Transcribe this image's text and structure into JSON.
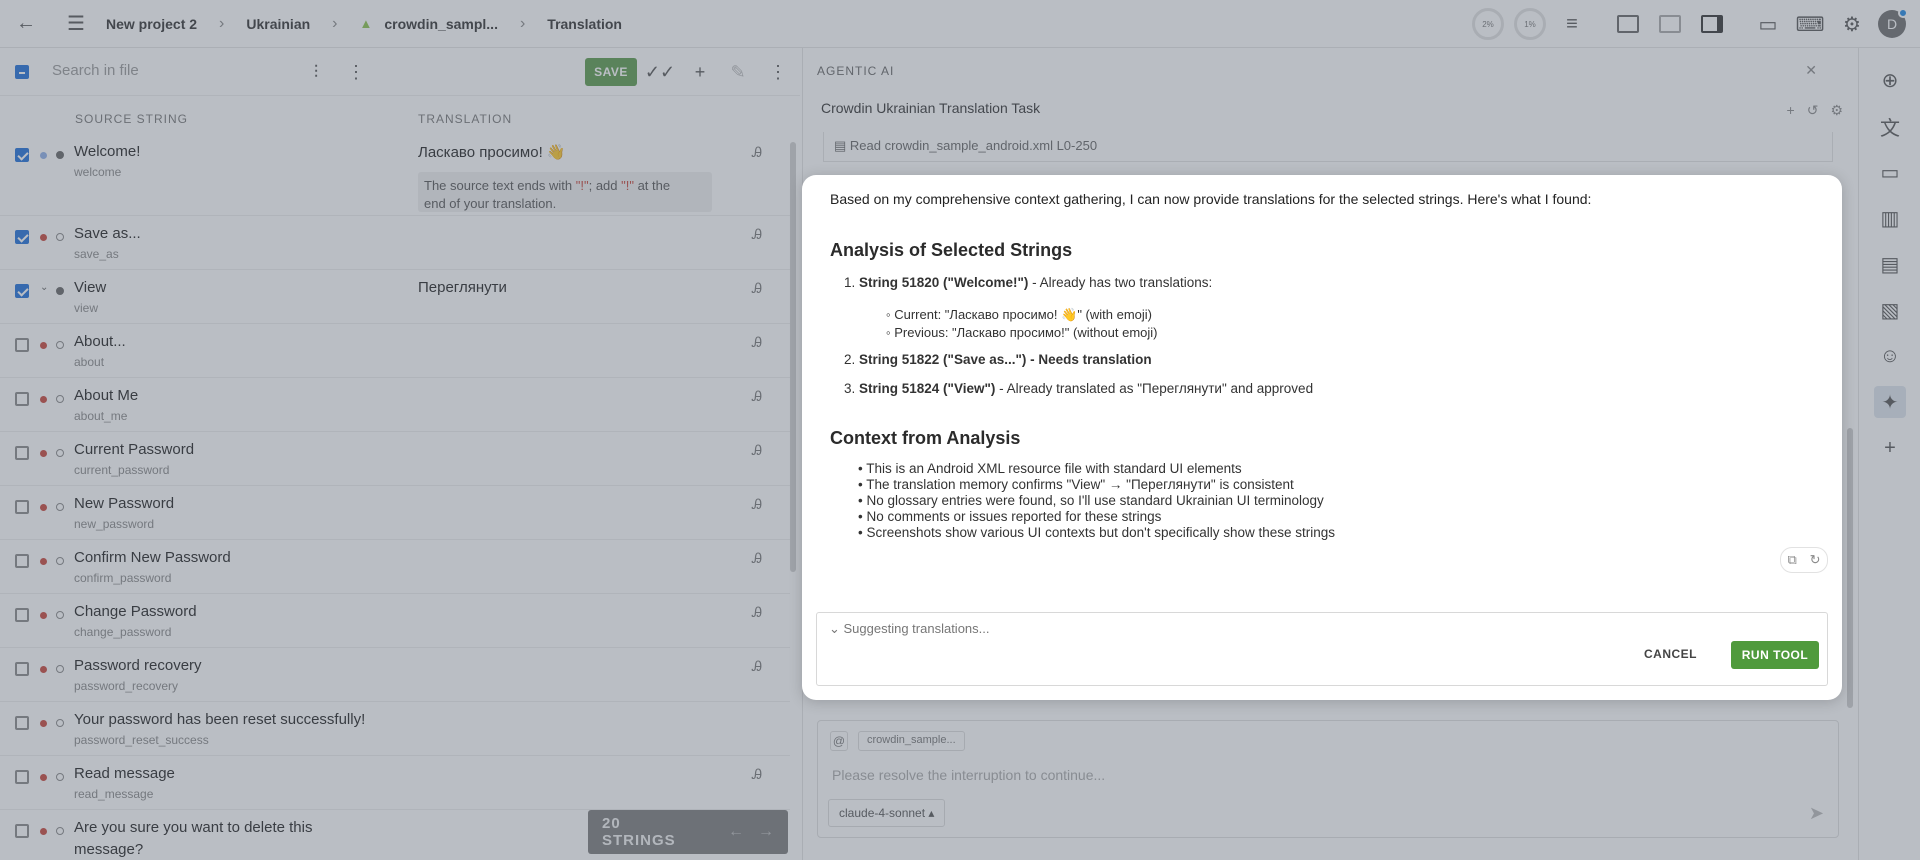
{
  "topbar": {
    "crumbs": [
      "New project 2",
      "Ukrainian",
      "crowdin_sampl...",
      "Translation"
    ],
    "progress_1": "2%",
    "progress_2": "1%",
    "avatar_letter": "D"
  },
  "editor": {
    "search_placeholder": "Search in file",
    "save_label": "SAVE",
    "col_source": "SOURCE STRING",
    "col_translation": "TRANSLATION",
    "rows": [
      {
        "source": "Welcome!",
        "key": "welcome",
        "translation": "Ласкаво просимо! 👋",
        "checked": true
      },
      {
        "source": "Save as...",
        "key": "save_as",
        "translation": "",
        "checked": true
      },
      {
        "source": "View",
        "key": "view",
        "translation": "Переглянути",
        "checked": true
      },
      {
        "source": "About...",
        "key": "about",
        "translation": "",
        "checked": false
      },
      {
        "source": "About Me",
        "key": "about_me",
        "translation": "",
        "checked": false
      },
      {
        "source": "Current Password",
        "key": "current_password",
        "translation": "",
        "checked": false
      },
      {
        "source": "New Password",
        "key": "new_password",
        "translation": "",
        "checked": false
      },
      {
        "source": "Confirm New Password",
        "key": "confirm_password",
        "translation": "",
        "checked": false
      },
      {
        "source": "Change Password",
        "key": "change_password",
        "translation": "",
        "checked": false
      },
      {
        "source": "Password recovery",
        "key": "password_recovery",
        "translation": "",
        "checked": false
      },
      {
        "source": "Your password has been reset successfully!",
        "key": "password_reset_success",
        "translation": "",
        "checked": false
      },
      {
        "source": "Read message",
        "key": "read_message",
        "translation": "",
        "checked": false
      },
      {
        "source": "Are you sure you want to delete this",
        "source_line2": "message?",
        "key": "",
        "translation": "",
        "checked": false
      }
    ],
    "qa_before": "The source text ends with ",
    "qa_hl1": "\"!\"",
    "qa_mid": "; add ",
    "qa_hl2": "\"!\"",
    "qa_after": " at the",
    "qa_line2": "end of your translation.",
    "strings_count": "20 STRINGS"
  },
  "ai": {
    "title": "AGENTIC AI",
    "task": "Crowdin Ukrainian Translation Task",
    "read_line": "Read crowdin_sample_android.xml L0-250",
    "input_file_chip": "crowdin_sample...",
    "input_placeholder": "Please resolve the interruption to continue...",
    "model": "claude-4-sonnet"
  },
  "modal": {
    "intro": "Based on my comprehensive context gathering, I can now provide translations for the selected strings. Here's what I found:",
    "h_analysis": "Analysis of Selected Strings",
    "item1_bold": "String 51820 (\"Welcome!\")",
    "item1_rest": " - Already has two translations:",
    "item1_sub1": "Current: \"Ласкаво просимо! 👋\" (with emoji)",
    "item1_sub2": "Previous: \"Ласкаво просимо!\" (without emoji)",
    "item2_bold": "String 51822 (\"Save as...\") - Needs translation",
    "item3_bold": "String 51824 (\"View\")",
    "item3_rest": " - Already translated as \"Переглянути\" and approved",
    "h_context": "Context from Analysis",
    "bullets": [
      "This is an Android XML resource file with standard UI elements",
      "The translation memory confirms \"View\" → \"Переглянути\" is consistent",
      "No glossary entries were found, so I'll use standard Ukrainian UI terminology",
      "No comments or issues reported for these strings",
      "Screenshots show various UI contexts but don't specifically show these strings"
    ],
    "suggesting": "Suggesting translations...",
    "cancel": "CANCEL",
    "run_tool": "RUN TOOL"
  }
}
